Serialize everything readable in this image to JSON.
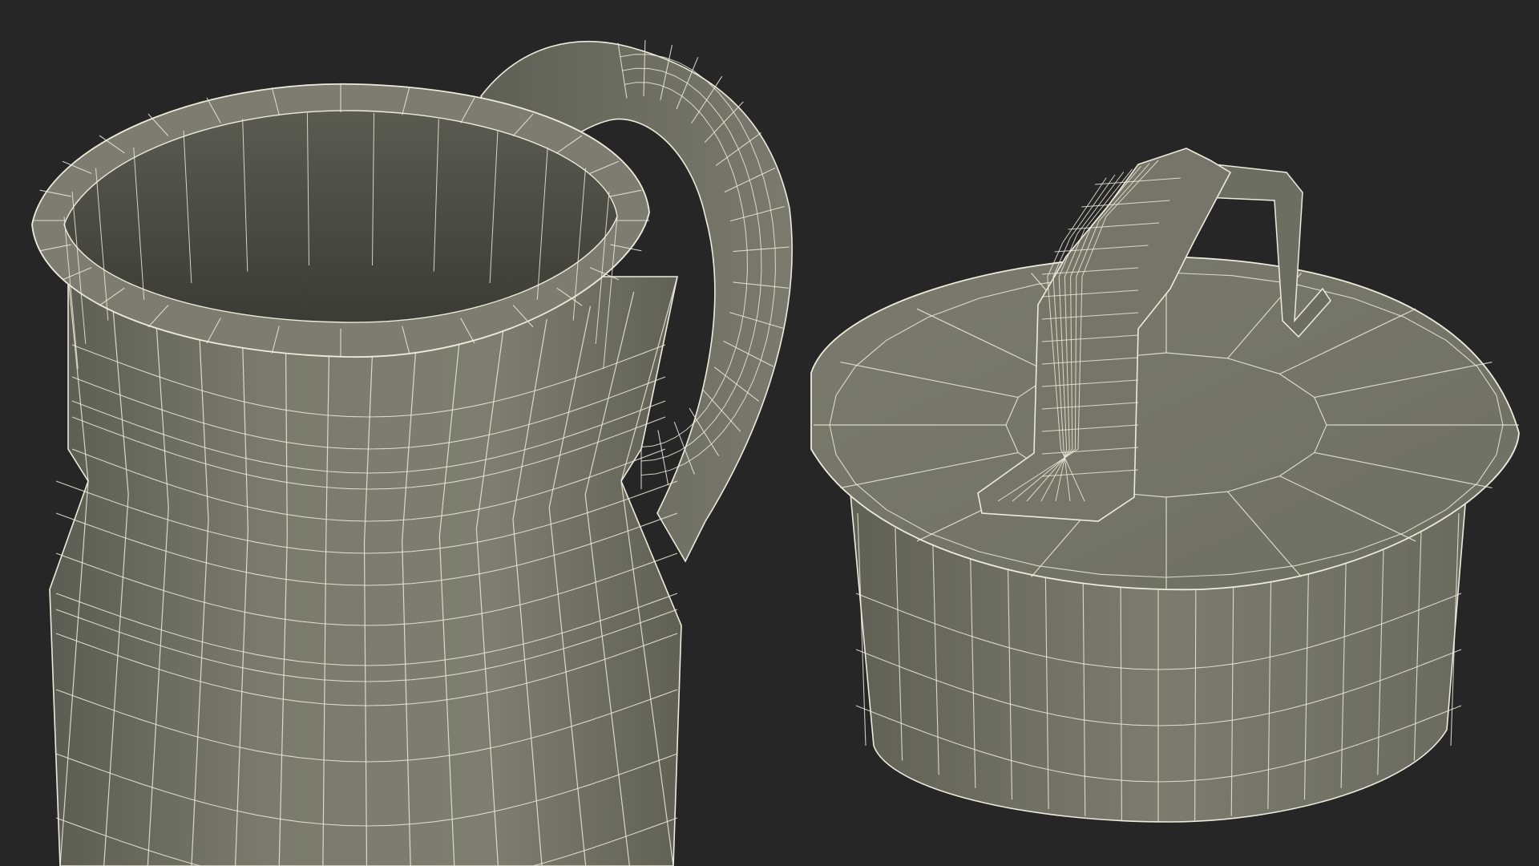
{
  "scene": {
    "background_color": "#262626",
    "surface_color": "#767769",
    "surface_shadow_color": "#5e5f53",
    "surface_light_color": "#85867a",
    "interior_color": "#4d4e45",
    "wire_color": "#ececdc",
    "objects": [
      {
        "name": "tankard-body",
        "segments": 14,
        "rows": 7
      },
      {
        "name": "tankard-handle",
        "segments": 4,
        "rows": 14
      },
      {
        "name": "lid",
        "segments": 16,
        "rows": 4
      },
      {
        "name": "lid-handle",
        "segments": 6,
        "rows": 10
      }
    ]
  }
}
